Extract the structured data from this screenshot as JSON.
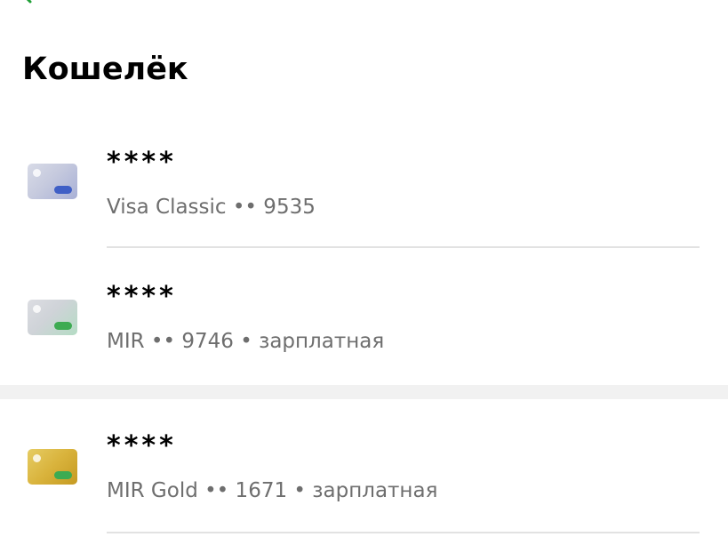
{
  "header": {
    "title": "Кошелёк",
    "back_icon": "chevron-left-icon",
    "accent_color": "#21a038"
  },
  "cards": [
    {
      "masked_balance": "****",
      "subtitle": "Visa Classic •• 9535",
      "icon": "card-icon",
      "stripe_color": "#3f5fc6"
    },
    {
      "masked_balance": "****",
      "subtitle": "MIR •• 9746 • зарплатная",
      "icon": "card-icon",
      "stripe_color": "#3dab52"
    },
    {
      "masked_balance": "****",
      "subtitle": "MIR Gold •• 1671 • зарплатная",
      "icon": "card-icon",
      "stripe_color": "#3dab52"
    }
  ]
}
